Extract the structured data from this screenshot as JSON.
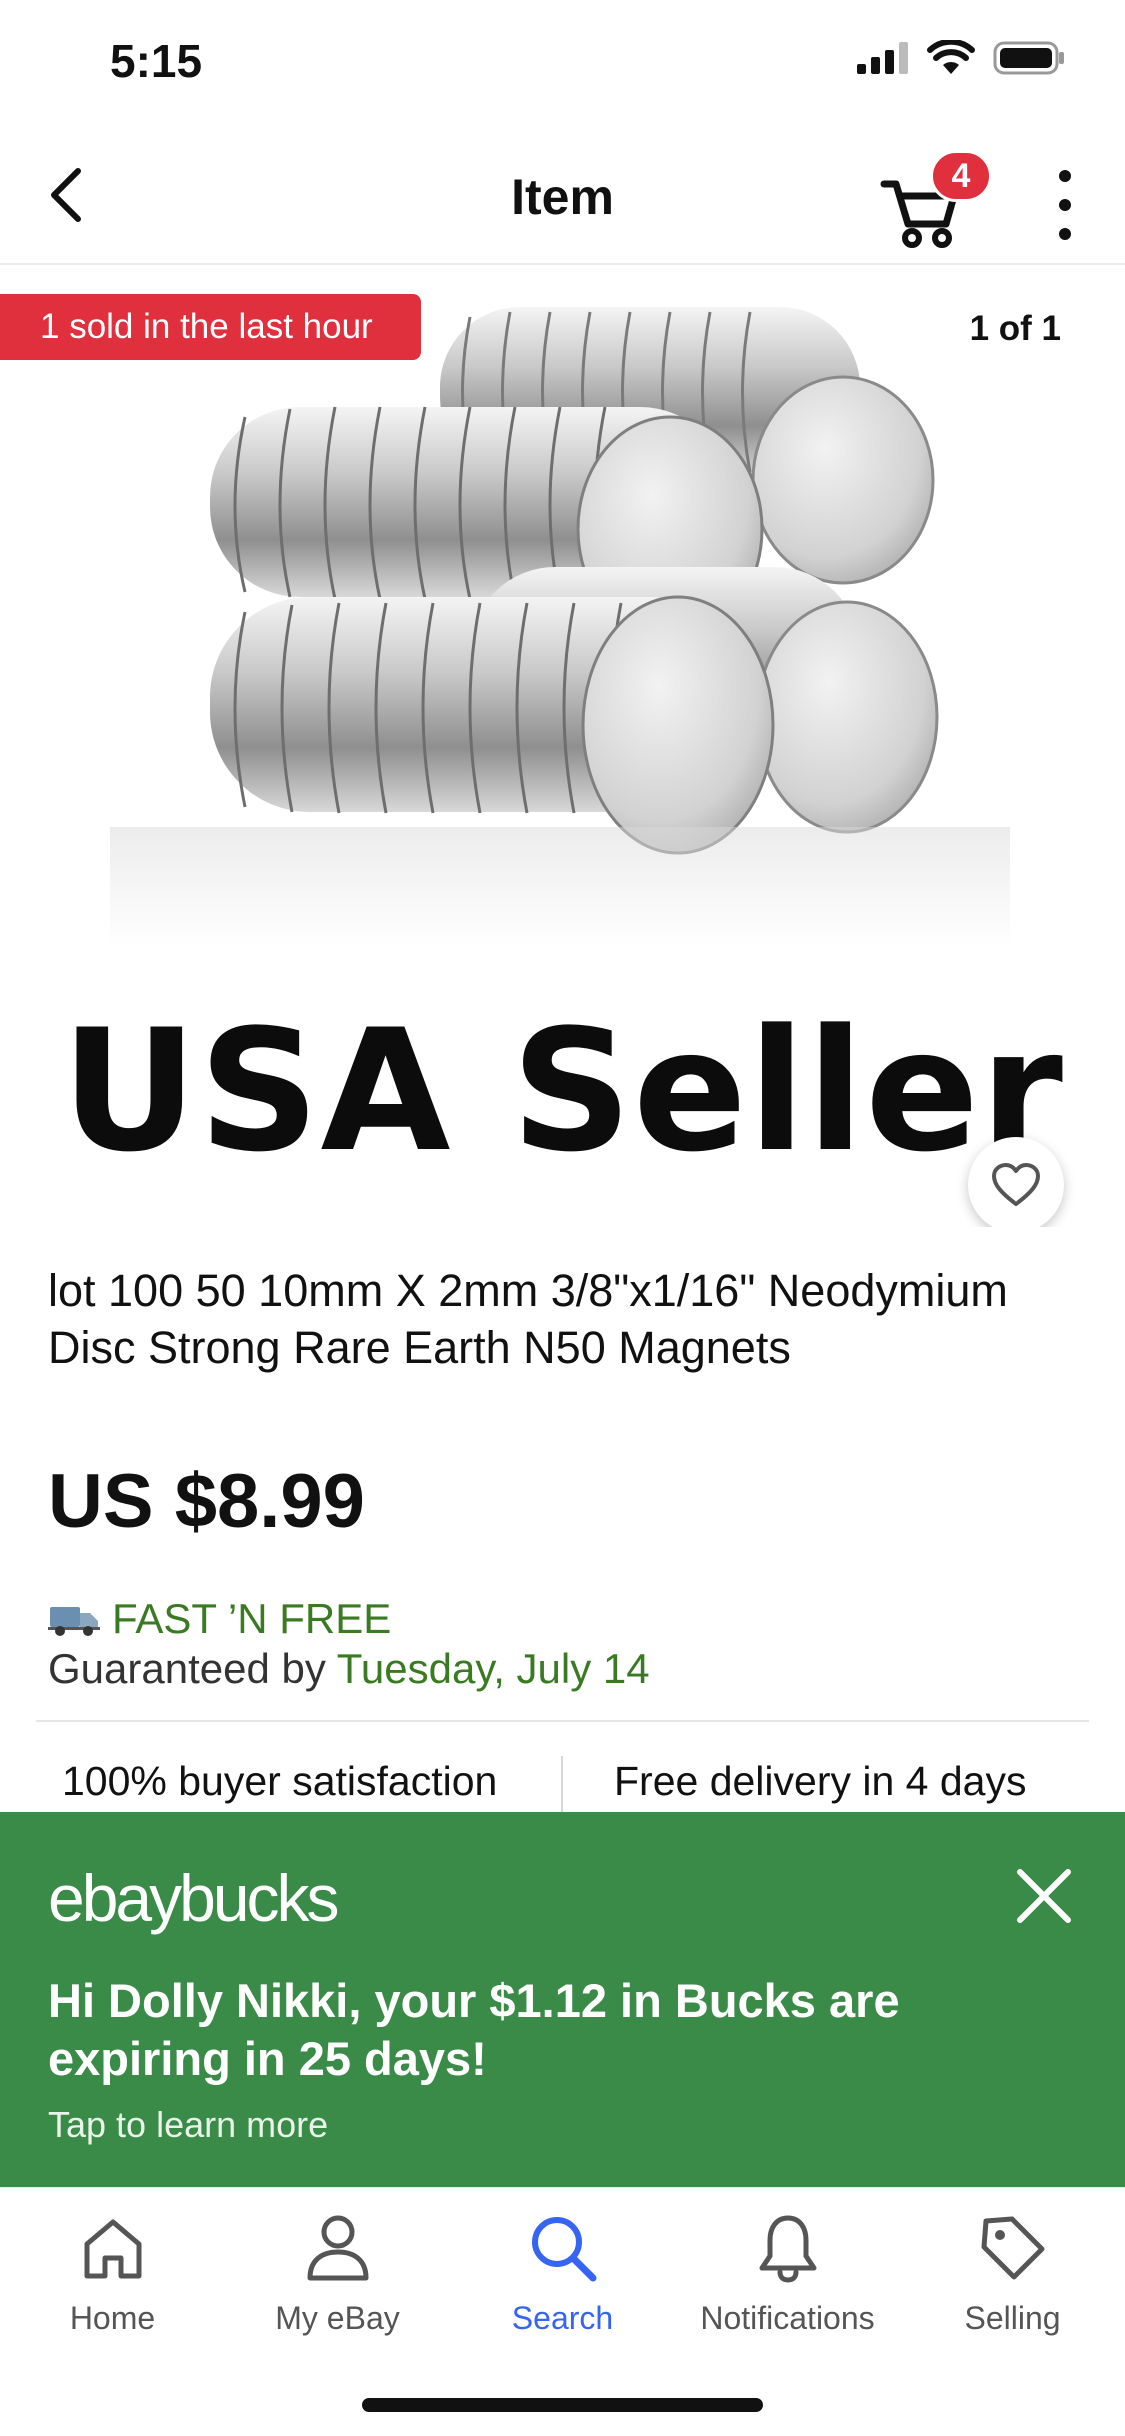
{
  "status_bar": {
    "time": "5:15"
  },
  "nav": {
    "title": "Item",
    "cart_count": "4"
  },
  "image": {
    "sold_badge": "1 sold in the last hour",
    "counter": "1 of 1",
    "overlay_text": "USA Seller"
  },
  "item": {
    "title": "lot 100 50 10mm X 2mm 3/8\"x1/16\" Neodymium Disc Strong Rare Earth N50 Magnets",
    "price": "US $8.99",
    "shipping_label": "FAST ’N FREE",
    "guarantee_prefix": "Guaranteed by",
    "guarantee_date": "Tuesday, July 14"
  },
  "stats": {
    "left": "100% buyer satisfaction",
    "right": "Free delivery in 4 days"
  },
  "bucks_banner": {
    "logo": "ebaybucks",
    "message": "Hi Dolly Nikki, your $1.12 in Bucks are expiring in 25 days!",
    "cta": "Tap to learn more"
  },
  "tabs": [
    {
      "label": "Home",
      "icon": "home-icon"
    },
    {
      "label": "My eBay",
      "icon": "person-icon"
    },
    {
      "label": "Search",
      "icon": "search-icon",
      "active": true
    },
    {
      "label": "Notifications",
      "icon": "bell-icon"
    },
    {
      "label": "Selling",
      "icon": "tag-icon"
    }
  ],
  "colors": {
    "badge_red": "#e0303e",
    "ship_green": "#3a7a22",
    "bucks_green": "#3a8a48",
    "active_blue": "#3665f3"
  }
}
